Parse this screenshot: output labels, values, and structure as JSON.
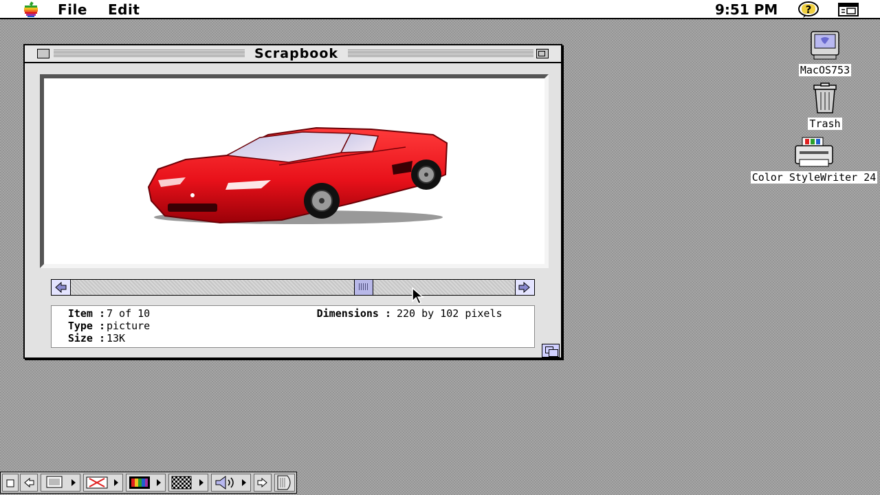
{
  "menubar": {
    "apple_icon": "apple-rainbow-icon",
    "file_label": "File",
    "edit_label": "Edit",
    "clock": "9:51 PM",
    "help_icon": "help-balloon-icon",
    "app_icon": "application-menu-icon"
  },
  "window": {
    "title": "Scrapbook",
    "image": "red-sports-car-picture",
    "info": {
      "item_label": "Item :",
      "item_value": "7 of 10",
      "type_label": "Type :",
      "type_value": "picture",
      "size_label": "Size :",
      "size_value": "13K",
      "dimensions_label": "Dimensions :",
      "dimensions_value": "220 by 102 pixels"
    }
  },
  "desktop_icons": [
    {
      "label": "MacOS753",
      "icon": "hard-disk-icon"
    },
    {
      "label": "Trash",
      "icon": "trash-icon"
    },
    {
      "label": "Color StyleWriter 24",
      "icon": "printer-icon"
    }
  ],
  "control_strip": {
    "icons": [
      "collapse-icon",
      "back-icon",
      "monitor-icon",
      "file-sharing-icon",
      "color-depth-icon",
      "desktop-pattern-icon",
      "sound-volume-icon",
      "forward-icon",
      "strip-tab-icon"
    ]
  },
  "colors": {
    "car_red": "#e8111a",
    "scrollbar_accent": "#b8b8e8",
    "desktop_gray": "#a6a6a6"
  }
}
